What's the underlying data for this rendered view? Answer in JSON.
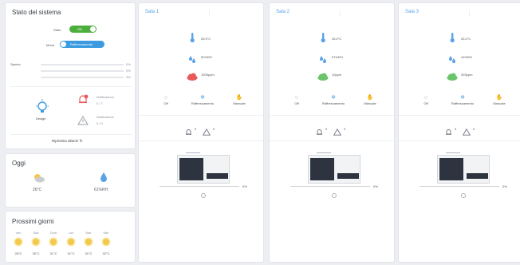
{
  "system": {
    "title": "Stato del sistema",
    "stato_label": "Stato",
    "stato_value": "ON",
    "mode_label": "Modo",
    "mode_value": "Raffrescamento",
    "spento_label": "Spento",
    "bars": [
      {
        "value": "0%",
        "fill": 0
      },
      {
        "value": "0%",
        "fill": 0
      },
      {
        "value": "0%",
        "fill": 0
      }
    ],
    "mode_icon_label": "Design",
    "notifications_label": "Notificazioni",
    "notifications_value": "0 / 7",
    "warnings_label": "Notificazioni",
    "warnings_value": "0 / 0",
    "reset_label": "Ripristina allarmi"
  },
  "today": {
    "title": "Oggi",
    "temp": "26°C",
    "humidity": "61%RH"
  },
  "forecast": {
    "title": "Prossimi giorni",
    "days": [
      {
        "day": "Ven",
        "temp": "28°C"
      },
      {
        "day": "Sab",
        "temp": "30°C"
      },
      {
        "day": "Dom",
        "temp": "31°C"
      },
      {
        "day": "Lun",
        "temp": "31°C"
      },
      {
        "day": "Mar",
        "temp": "31°C"
      },
      {
        "day": "Mer",
        "temp": "32°C"
      }
    ]
  },
  "rooms": [
    {
      "title": "Sala 1",
      "temperature": "26.9°C",
      "humidity": "52%RH",
      "co2": "1905ppm",
      "co2_color": "#e85a5a",
      "modes": [
        "Off",
        "Raffrescamento",
        "Manuale"
      ],
      "alarm_count": "0",
      "warning_count": "0",
      "slider_value": "0%",
      "slider_fill": 0
    },
    {
      "title": "Sala 2",
      "temperature": "26.0°C",
      "humidity": "57%RH",
      "co2": "10ppm",
      "co2_color": "#6ac46a",
      "modes": [
        "Off",
        "Raffrescamento",
        "Manuale"
      ],
      "alarm_count": "0",
      "warning_count": "0",
      "slider_value": "0%",
      "slider_fill": 0
    },
    {
      "title": "Sala 3",
      "temperature": "25.4°C",
      "humidity": "42%RH",
      "co2": "493ppm",
      "co2_color": "#6ac46a",
      "modes": [
        "Off",
        "Raffrescamento",
        "Manuale"
      ],
      "alarm_count": "0",
      "warning_count": "0",
      "slider_value": "0%",
      "slider_fill": 0
    }
  ],
  "colors": {
    "accent": "#5aa2e6",
    "toggle_on": "#4caf3d",
    "mode_pill": "#3c9be0",
    "alarm_red": "#e85a5a"
  }
}
